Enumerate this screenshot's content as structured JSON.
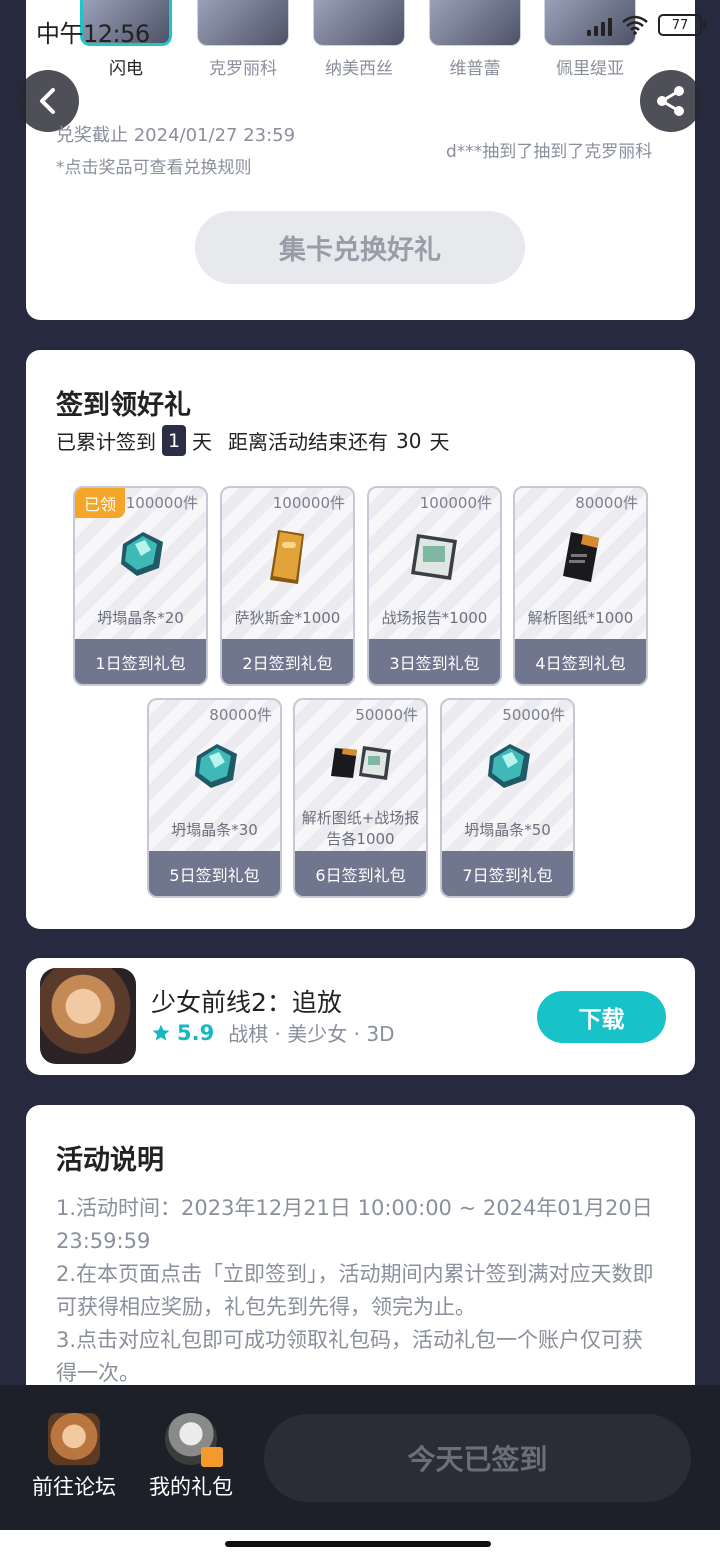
{
  "status_bar": {
    "time": "中午12:56",
    "battery": "77"
  },
  "characters": [
    {
      "name": "闪电",
      "selected": true
    },
    {
      "name": "克罗丽科",
      "selected": false
    },
    {
      "name": "纳美西丝",
      "selected": false
    },
    {
      "name": "维普蕾",
      "selected": false
    },
    {
      "name": "佩里缇亚",
      "selected": false
    }
  ],
  "exchange": {
    "deadline": "兑奖截止 2024/01/27 23:59",
    "hint": "*点击奖品可查看兑换规则",
    "winner_ticker": "d***抽到了抽到了克罗丽科",
    "button": "集卡兑换好礼"
  },
  "signin": {
    "title": "签到领好礼",
    "progress_prefix": "已累计签到",
    "days": "1",
    "progress_suffix": "天",
    "remaining_prefix": "距离活动结束还有",
    "remaining_days": "30",
    "remaining_suffix": "天",
    "claimed_badge": "已领",
    "gifts": [
      {
        "count": "100000件",
        "name": "坍塌晶条*20",
        "footer": "1日签到礼包",
        "claimed": true,
        "icon": "crystal-icon"
      },
      {
        "count": "100000件",
        "name": "萨狄斯金*1000",
        "footer": "2日签到礼包",
        "claimed": false,
        "icon": "gold-bar-icon"
      },
      {
        "count": "100000件",
        "name": "战场报告*1000",
        "footer": "3日签到礼包",
        "claimed": false,
        "icon": "report-icon"
      },
      {
        "count": "80000件",
        "name": "解析图纸*1000",
        "footer": "4日签到礼包",
        "claimed": false,
        "icon": "blueprint-icon"
      },
      {
        "count": "80000件",
        "name": "坍塌晶条*30",
        "footer": "5日签到礼包",
        "claimed": false,
        "icon": "crystal-icon"
      },
      {
        "count": "50000件",
        "name": "解析图纸+战场报告各1000",
        "footer": "6日签到礼包",
        "claimed": false,
        "icon": "blueprint-report-icon"
      },
      {
        "count": "50000件",
        "name": "坍塌晶条*50",
        "footer": "7日签到礼包",
        "claimed": false,
        "icon": "crystal-icon"
      }
    ]
  },
  "app": {
    "name": "少女前线2：追放",
    "rating": "5.9",
    "tags": "战棋 · 美少女 · 3D",
    "download": "下载"
  },
  "rules": {
    "title": "活动说明",
    "lines": [
      "1.活动时间：2023年12月21日 10:00:00 ~ 2024年01月20日 23:59:59",
      "2.在本页面点击「立即签到」，活动期间内累计签到满对应天数即可获得相应奖励，礼包先到先得，领完为止。",
      "3.点击对应礼包即可成功领取礼包码，活动礼包一个账户仅可获得一次。"
    ]
  },
  "bottom_bar": {
    "forum": "前往论坛",
    "my_gifts": "我的礼包",
    "signed": "今天已签到"
  },
  "colors": {
    "accent": "#17c2c9",
    "claimed": "#f4a629",
    "footer": "#70768d",
    "page_bg": "#27293f"
  }
}
